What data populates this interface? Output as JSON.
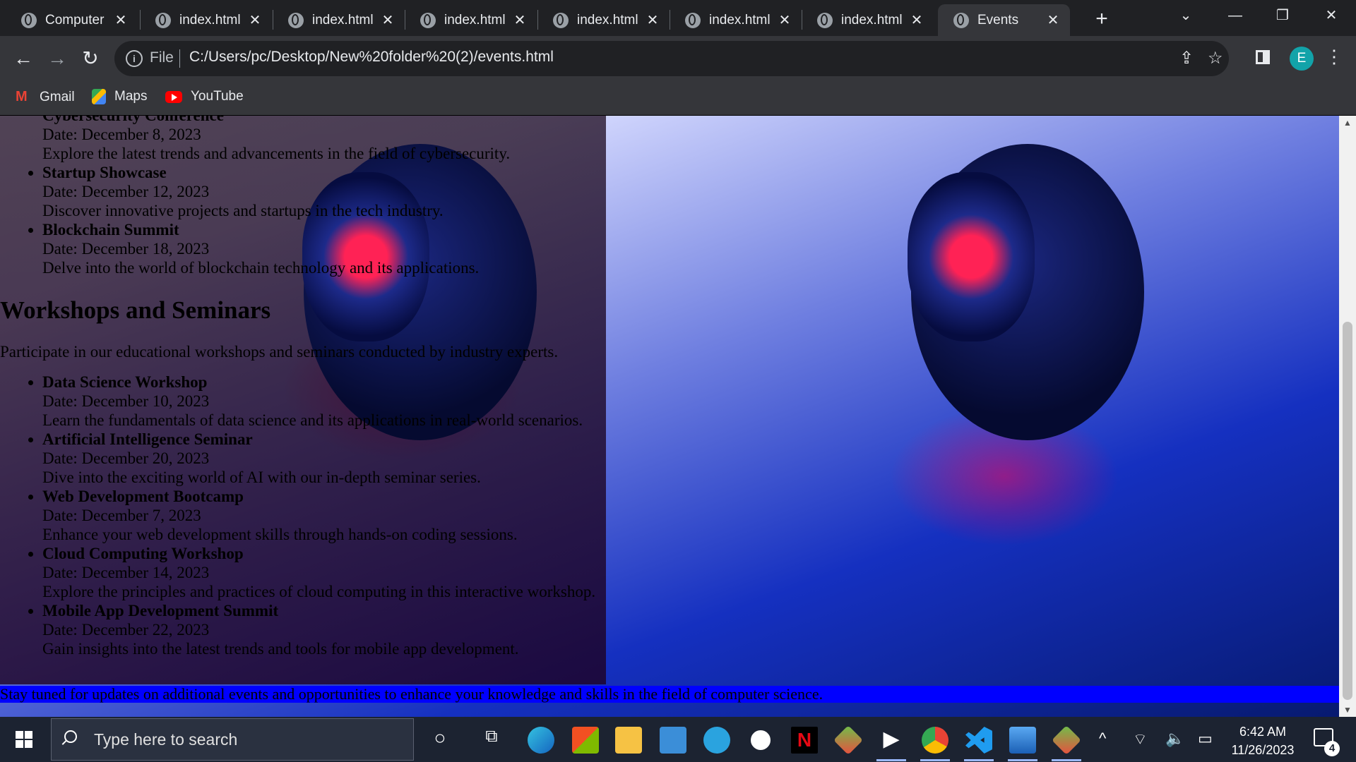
{
  "browser": {
    "tabs": [
      {
        "label": "Computer",
        "active": false
      },
      {
        "label": "index.html",
        "active": false
      },
      {
        "label": "index.html",
        "active": false
      },
      {
        "label": "index.html",
        "active": false
      },
      {
        "label": "index.html",
        "active": false
      },
      {
        "label": "index.html",
        "active": false
      },
      {
        "label": "index.html",
        "active": false
      },
      {
        "label": "Events",
        "active": true
      }
    ],
    "tab_close_glyph": "✕",
    "new_tab_glyph": "+",
    "window_controls": {
      "dropdown": "⌄",
      "minimize": "—",
      "restore": "❐",
      "close": "✕"
    },
    "address": {
      "scheme_label": "File",
      "url": "C:/Users/pc/Desktop/New%20folder%20(2)/events.html"
    },
    "profile_initial": "E",
    "bookmarks": [
      {
        "label": "Gmail",
        "icon": "gmail-icon"
      },
      {
        "label": "Maps",
        "icon": "maps-icon"
      },
      {
        "label": "YouTube",
        "icon": "youtube-icon"
      }
    ]
  },
  "page": {
    "partial_heading": "Cybersecurity Conference",
    "partial_date": "Date: December 8, 2023",
    "partial_desc": "Explore the latest trends and advancements in the field of cybersecurity.",
    "conferences": [
      {
        "name": "Startup Showcase",
        "date": "Date: December 12, 2023",
        "desc": "Discover innovative projects and startups in the tech industry."
      },
      {
        "name": "Blockchain Summit",
        "date": "Date: December 18, 2023",
        "desc": "Delve into the world of blockchain technology and its applications."
      }
    ],
    "workshops_title": "Workshops and Seminars",
    "workshops_intro": "Participate in our educational workshops and seminars conducted by industry experts.",
    "workshops": [
      {
        "name": "Data Science Workshop",
        "date": "Date: December 10, 2023",
        "desc": "Learn the fundamentals of data science and its applications in real-world scenarios."
      },
      {
        "name": "Artificial Intelligence Seminar",
        "date": "Date: December 20, 2023",
        "desc": "Dive into the exciting world of AI with our in-depth seminar series."
      },
      {
        "name": "Web Development Bootcamp",
        "date": "Date: December 7, 2023",
        "desc": "Enhance your web development skills through hands-on coding sessions."
      },
      {
        "name": "Cloud Computing Workshop",
        "date": "Date: December 14, 2023",
        "desc": "Explore the principles and practices of cloud computing in this interactive workshop."
      },
      {
        "name": "Mobile App Development Summit",
        "date": "Date: December 22, 2023",
        "desc": "Gain insights into the latest trends and tools for mobile app development."
      }
    ],
    "footer": "Stay tuned for updates on additional events and opportunities to enhance your knowledge and skills in the field of computer science."
  },
  "taskbar": {
    "search_placeholder": "Type here to search",
    "time": "6:42 AM",
    "date": "11/26/2023",
    "notification_count": "4",
    "apps": [
      "cortana-icon",
      "task-view-icon",
      "edge-icon",
      "store-icon",
      "file-explorer-icon",
      "mail-icon",
      "telegram-icon",
      "whatsapp-icon",
      "netflix-icon",
      "git-icon",
      "media-icon",
      "chrome-icon",
      "vscode-icon",
      "photos-icon",
      "git-icon"
    ]
  },
  "colors": {
    "footer_bar": "#0000ff",
    "chrome_dark": "#202124",
    "chrome_toolbar": "#35363a"
  }
}
